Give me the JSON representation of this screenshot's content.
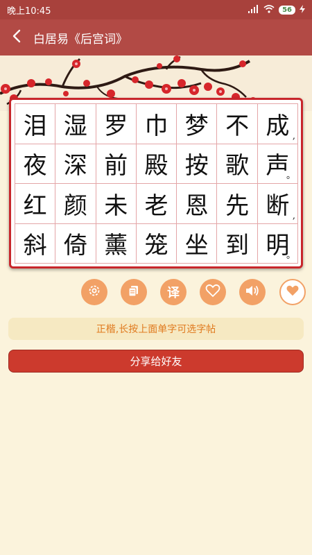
{
  "status": {
    "time": "晚上10:45",
    "battery": "56"
  },
  "header": {
    "title": "白居易《后宫词》"
  },
  "grid": {
    "rows": [
      [
        {
          "c": "泪",
          "p": ""
        },
        {
          "c": "湿",
          "p": ""
        },
        {
          "c": "罗",
          "p": ""
        },
        {
          "c": "巾",
          "p": ""
        },
        {
          "c": "梦",
          "p": ""
        },
        {
          "c": "不",
          "p": ""
        },
        {
          "c": "成",
          "p": ","
        }
      ],
      [
        {
          "c": "夜",
          "p": ""
        },
        {
          "c": "深",
          "p": ""
        },
        {
          "c": "前",
          "p": ""
        },
        {
          "c": "殿",
          "p": ""
        },
        {
          "c": "按",
          "p": ""
        },
        {
          "c": "歌",
          "p": ""
        },
        {
          "c": "声",
          "p": "。"
        }
      ],
      [
        {
          "c": "红",
          "p": ""
        },
        {
          "c": "颜",
          "p": ""
        },
        {
          "c": "未",
          "p": ""
        },
        {
          "c": "老",
          "p": ""
        },
        {
          "c": "恩",
          "p": ""
        },
        {
          "c": "先",
          "p": ""
        },
        {
          "c": "断",
          "p": ","
        }
      ],
      [
        {
          "c": "斜",
          "p": ""
        },
        {
          "c": "倚",
          "p": ""
        },
        {
          "c": "薰",
          "p": ""
        },
        {
          "c": "笼",
          "p": ""
        },
        {
          "c": "坐",
          "p": ""
        },
        {
          "c": "到",
          "p": ""
        },
        {
          "c": "明",
          "p": "。"
        }
      ]
    ]
  },
  "toolbar": {
    "items": [
      {
        "name": "settings-icon"
      },
      {
        "name": "copy-icon"
      },
      {
        "name": "translate-icon",
        "label": "译"
      },
      {
        "name": "heart-outline-icon"
      },
      {
        "name": "speaker-icon"
      },
      {
        "name": "heart-filled-icon"
      }
    ]
  },
  "hint": {
    "text": "正楷,长按上面单字可选字帖"
  },
  "share": {
    "label": "分享给好友"
  },
  "colors": {
    "appbar": "#b24a45",
    "accent": "#f2a166",
    "grid_border": "#c8262b",
    "share": "#cc3a2d"
  }
}
